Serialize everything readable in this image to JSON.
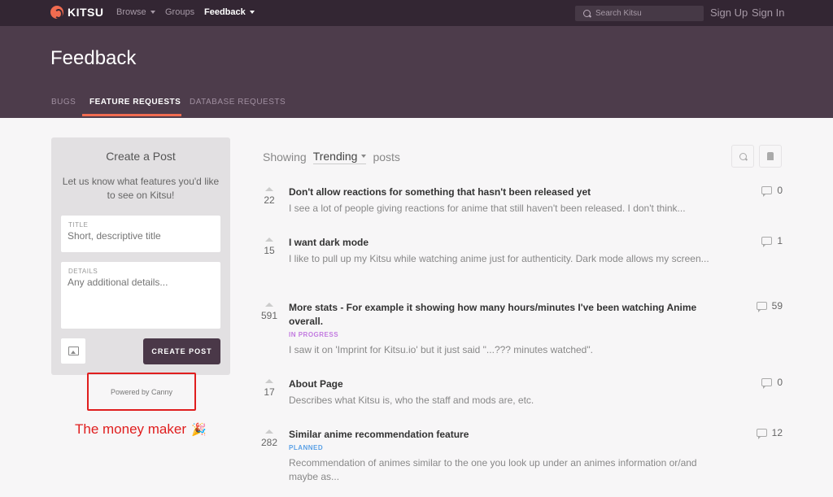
{
  "topnav": {
    "brand": "KITSU",
    "items": [
      {
        "label": "Browse",
        "has_caret": true
      },
      {
        "label": "Groups",
        "has_caret": false
      },
      {
        "label": "Feedback",
        "has_caret": true
      }
    ],
    "search_placeholder": "Search Kitsu",
    "sign_up": "Sign Up",
    "sign_in": "Sign In"
  },
  "header": {
    "title": "Feedback",
    "tabs": [
      {
        "label": "BUGS"
      },
      {
        "label": "FEATURE REQUESTS",
        "active": true
      },
      {
        "label": "DATABASE REQUESTS"
      }
    ]
  },
  "create_post": {
    "title": "Create a Post",
    "description": "Let us know what features you'd like to see on Kitsu!",
    "title_label": "TITLE",
    "title_placeholder": "Short, descriptive title",
    "details_label": "DETAILS",
    "details_placeholder": "Any additional details...",
    "button": "CREATE POST",
    "powered_by": "Powered by Canny"
  },
  "annotation": {
    "text": "The money maker",
    "emoji": "🎉",
    "color": "#e01e1e"
  },
  "sort": {
    "prefix": "Showing",
    "selected": "Trending",
    "suffix": "posts"
  },
  "posts": [
    {
      "votes": "22",
      "title": "Don't allow reactions for something that hasn't been released yet",
      "status": "",
      "description": "I see a lot of people giving reactions for anime that still haven't been released. I don't think...",
      "comments": "0"
    },
    {
      "votes": "15",
      "title": "I want dark mode",
      "status": "",
      "description": "I like to pull up my Kitsu while watching anime just for authenticity. Dark mode allows my screen...",
      "comments": "1"
    },
    {
      "votes": "591",
      "title": "More stats - For example it showing how many hours/minutes I've been watching Anime overall.",
      "status": "IN PROGRESS",
      "description": "I saw it on 'Imprint for Kitsu.io' but it just said \"...??? minutes watched\".",
      "comments": "59"
    },
    {
      "votes": "17",
      "title": "About Page",
      "status": "",
      "description": "Describes what Kitsu is, who the staff and mods are, etc.",
      "comments": "0"
    },
    {
      "votes": "282",
      "title": "Similar anime recommendation feature",
      "status": "PLANNED",
      "description": "Recommendation of animes similar to the one you look up under an animes information or/and maybe as...",
      "comments": "12"
    }
  ],
  "colors": {
    "nav_bg": "#332633",
    "header_bg": "#4d3c4b",
    "accent": "#f06b50",
    "in_progress": "#c27ae0",
    "planned": "#5aa0e6"
  }
}
